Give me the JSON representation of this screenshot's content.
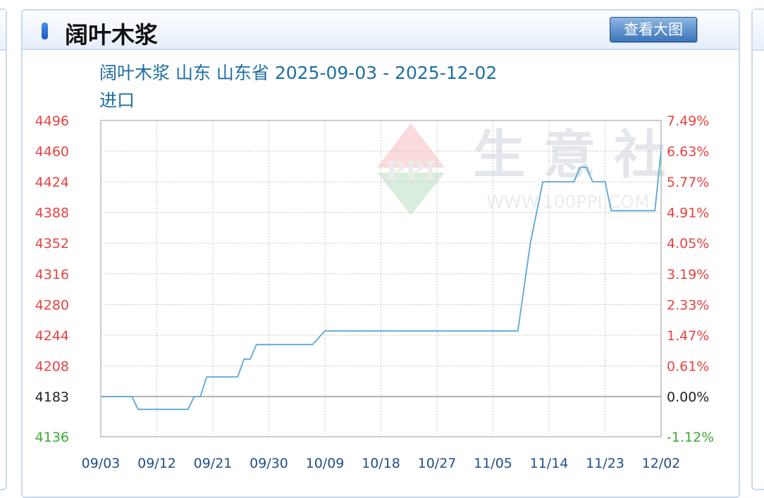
{
  "panel": {
    "title": "阔叶木浆",
    "big_button_label": "查看大图"
  },
  "chart_data": {
    "type": "line",
    "title_line1": "阔叶木浆 山东 山东省 2025-09-03 - 2025-12-02",
    "title_line2": "进口",
    "watermark": {
      "brand": "生 意 社",
      "url": "WWW.100PPI.COM",
      "logo_text": "PPI"
    },
    "x_tick_labels": [
      "09/03",
      "09/12",
      "09/21",
      "09/30",
      "10/09",
      "10/18",
      "10/27",
      "11/05",
      "11/14",
      "11/23",
      "12/02"
    ],
    "x_range": [
      "2025-09-03",
      "2025-12-02"
    ],
    "y_left_ticks": [
      {
        "value": 4496,
        "label": "4496"
      },
      {
        "value": 4460,
        "label": "4460"
      },
      {
        "value": 4424,
        "label": "4424"
      },
      {
        "value": 4388,
        "label": "4388"
      },
      {
        "value": 4352,
        "label": "4352"
      },
      {
        "value": 4316,
        "label": "4316"
      },
      {
        "value": 4280,
        "label": "4280"
      },
      {
        "value": 4244,
        "label": "4244"
      },
      {
        "value": 4208,
        "label": "4208"
      },
      {
        "value": 4183,
        "label": "4183"
      },
      {
        "value": 4136,
        "label": "4136"
      }
    ],
    "y_right_ticks": [
      {
        "value": 4496,
        "label": "7.49%"
      },
      {
        "value": 4460,
        "label": "6.63%"
      },
      {
        "value": 4424,
        "label": "5.77%"
      },
      {
        "value": 4388,
        "label": "4.91%"
      },
      {
        "value": 4352,
        "label": "4.05%"
      },
      {
        "value": 4316,
        "label": "3.19%"
      },
      {
        "value": 4280,
        "label": "2.33%"
      },
      {
        "value": 4244,
        "label": "1.47%"
      },
      {
        "value": 4208,
        "label": "0.61%"
      },
      {
        "value": 4183,
        "label": "0.00%"
      },
      {
        "value": 4136,
        "label": "-1.12%"
      }
    ],
    "ylim": [
      4136,
      4496
    ],
    "baseline": 4183,
    "grid": true,
    "colors": {
      "line": "#5aa6d8",
      "up_labels": "#e8423f",
      "down_labels": "#3aaa35",
      "base_label": "#222222",
      "title": "#1d6fa0",
      "axis_labels": "#1d4f8a",
      "grid": "#c8c8c8"
    },
    "series": [
      {
        "values": [
          {
            "x": "2025-09-03",
            "y": 4183
          },
          {
            "x": "2025-09-08",
            "y": 4183
          },
          {
            "x": "2025-09-09",
            "y": 4168
          },
          {
            "x": "2025-09-16",
            "y": 4168
          },
          {
            "x": "2025-09-17",
            "y": 4168
          },
          {
            "x": "2025-09-18",
            "y": 4183
          },
          {
            "x": "2025-09-19",
            "y": 4183
          },
          {
            "x": "2025-09-20",
            "y": 4199
          },
          {
            "x": "2025-09-24",
            "y": 4199
          },
          {
            "x": "2025-09-25",
            "y": 4199
          },
          {
            "x": "2025-09-26",
            "y": 4216
          },
          {
            "x": "2025-09-27",
            "y": 4216
          },
          {
            "x": "2025-09-28",
            "y": 4233
          },
          {
            "x": "2025-10-06",
            "y": 4233
          },
          {
            "x": "2025-10-07",
            "y": 4233
          },
          {
            "x": "2025-10-09",
            "y": 4249
          },
          {
            "x": "2025-11-09",
            "y": 4249
          },
          {
            "x": "2025-11-11",
            "y": 4352
          },
          {
            "x": "2025-11-13",
            "y": 4424
          },
          {
            "x": "2025-11-17",
            "y": 4424
          },
          {
            "x": "2025-11-18",
            "y": 4424
          },
          {
            "x": "2025-11-19",
            "y": 4441
          },
          {
            "x": "2025-11-20",
            "y": 4441
          },
          {
            "x": "2025-11-21",
            "y": 4424
          },
          {
            "x": "2025-11-22",
            "y": 4424
          },
          {
            "x": "2025-11-23",
            "y": 4424
          },
          {
            "x": "2025-11-24",
            "y": 4390
          },
          {
            "x": "2025-12-01",
            "y": 4390
          },
          {
            "x": "2025-12-02",
            "y": 4460
          }
        ]
      }
    ]
  }
}
